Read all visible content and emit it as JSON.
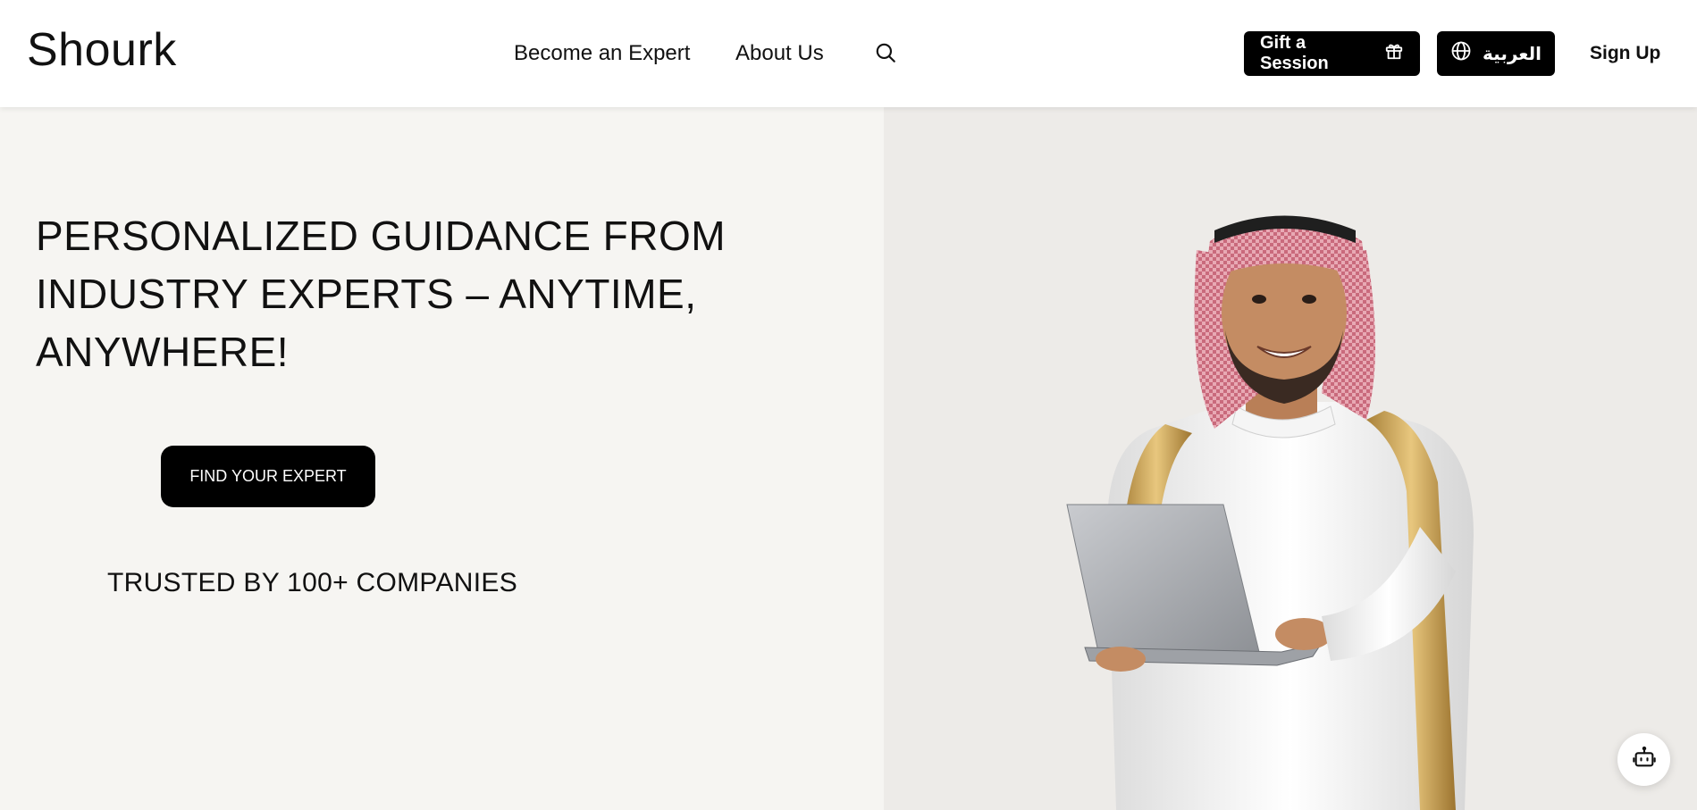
{
  "brand": {
    "logo_text": "Shourk"
  },
  "nav": {
    "become_expert": "Become an Expert",
    "about_us": "About Us",
    "search_icon": "search-icon"
  },
  "header_actions": {
    "gift_label": "Gift a Session",
    "gift_icon": "gift-icon",
    "language_label": "العربية",
    "language_icon": "globe-icon",
    "signup_label": "Sign Up"
  },
  "hero": {
    "title_line1": "PERSONALIZED GUIDANCE FROM",
    "title_line2": "INDUSTRY EXPERTS – ANYTIME,",
    "title_line3": "ANYWHERE!",
    "cta_label": "FIND YOUR EXPERT",
    "trusted_text": "TRUSTED BY 100+ COMPANIES",
    "image_subject": "expert-with-laptop-photo"
  },
  "chat": {
    "icon": "robot-icon"
  },
  "colors": {
    "primary": "#000000",
    "hero_left_bg": "#f6f5f2",
    "hero_right_bg": "#edebe8",
    "text": "#111111"
  }
}
